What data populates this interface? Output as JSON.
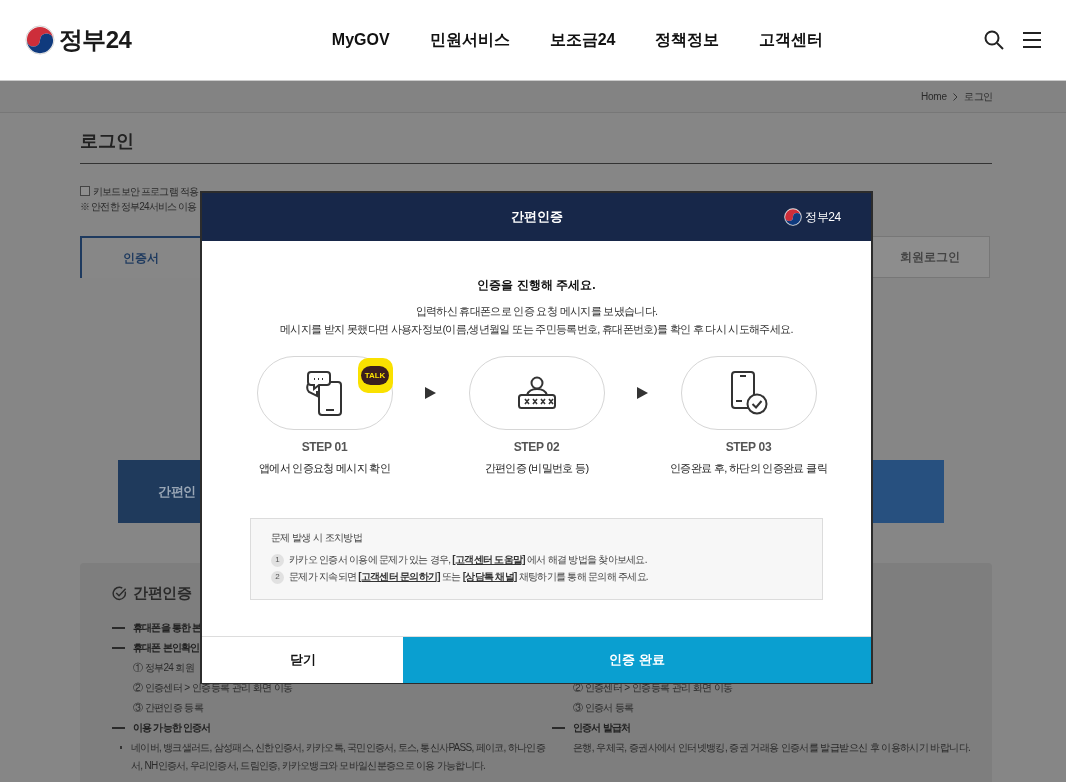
{
  "header": {
    "logo": "정부24",
    "nav": [
      {
        "label": "MyGOV"
      },
      {
        "label": "민원서비스"
      },
      {
        "label": "보조금24"
      },
      {
        "label": "정책정보"
      },
      {
        "label": "고객센터"
      }
    ]
  },
  "breadcrumb": [
    "Home",
    "로그인"
  ],
  "page": {
    "title": "로그인",
    "keyboard_security": {
      "label": "키보드보안 프로그램 적용",
      "checked": false
    },
    "notice": "※ 안전한 정부24서비스 이용",
    "tabs": [
      {
        "label": "인증서",
        "selected": true
      },
      {
        "label": "회원로그인",
        "selected": false
      }
    ],
    "simple_auth_button": "간편인",
    "info": {
      "title": "간편인증",
      "left": [
        {
          "kind": "heading",
          "text": "휴대폰을 통한 본"
        },
        {
          "kind": "heading",
          "text": "휴대폰 본인확인"
        },
        {
          "kind": "step",
          "text": "① 정부24 회원"
        },
        {
          "kind": "step",
          "text": "② 인증센터 > 인증등록 관리 화면 이동"
        },
        {
          "kind": "step",
          "text": "③ 간편인증 등록"
        },
        {
          "kind": "heading",
          "text": "이용 가능한 인증서"
        },
        {
          "kind": "bullet",
          "text": "네이버, 뱅크샐러드, 삼성패스, 신한인증서, 카카오톡, 국민인증서, 토스, 통신사PASS, 페이코, 하나인증서, NH인증서, 우리인증서, 드림인증, 카카오뱅크와 모바일신분증으로 이용 가능합니다."
        }
      ],
      "right": [
        {
          "kind": "step",
          "text": "② 인증센터 > 인증등록 관리 화면 이동"
        },
        {
          "kind": "step",
          "text": "③ 인증서 등록"
        },
        {
          "kind": "heading",
          "text": "인증서 발급처"
        },
        {
          "kind": "plain",
          "text": "은행, 우체국, 증권사에서 인터넷뱅킹, 증권 거래용 인증서를 발급받으신 후 이용하시기 바랍니다."
        }
      ]
    }
  },
  "dialog": {
    "title": "간편인증",
    "logo": "정부24",
    "heading": "인증을 진행해 주세요.",
    "message": [
      "입력하신 휴대폰으로 인증 요청 메시지를 보냈습니다.",
      "메시지를 받지 못했다면 사용자정보(이름,생년월일 또는 주민등록번호, 휴대폰번호)를 확인 후 다시 시도해주세요."
    ],
    "steps": [
      {
        "kind": "message",
        "badge": "TALK",
        "label": "STEP 01",
        "text": "앱에서 인증요청 메시지 확인"
      },
      {
        "kind": "password",
        "label": "STEP 02",
        "text": "간편인증 (비밀번호 등)"
      },
      {
        "kind": "complete",
        "label": "STEP 03",
        "text": "인증완료 후, 하단의 인증완료 클릭"
      }
    ],
    "help": {
      "title": "문제 발생 시 조치방법",
      "items": [
        {
          "number": "1",
          "parts": [
            {
              "kind": "text",
              "text": "카카오 인증서 이용에 문제가 있는 경우, "
            },
            {
              "kind": "link",
              "text": "[고객센터 도움말]"
            },
            {
              "kind": "text",
              "text": " 에서 해결 방법을 찾아보세요."
            }
          ]
        },
        {
          "number": "2",
          "parts": [
            {
              "kind": "text",
              "text": "문제가 지속되면 "
            },
            {
              "kind": "link",
              "text": "[고객센터 문의하기]"
            },
            {
              "kind": "text",
              "text": " 또는 "
            },
            {
              "kind": "link",
              "text": "[상담톡 채널]"
            },
            {
              "kind": "text",
              "text": " 채팅하기를 통해 문의해 주세요."
            }
          ]
        }
      ]
    },
    "buttons": [
      {
        "kind": "close",
        "label": "닫기"
      },
      {
        "kind": "confirm",
        "label": "인증 완료"
      }
    ]
  }
}
